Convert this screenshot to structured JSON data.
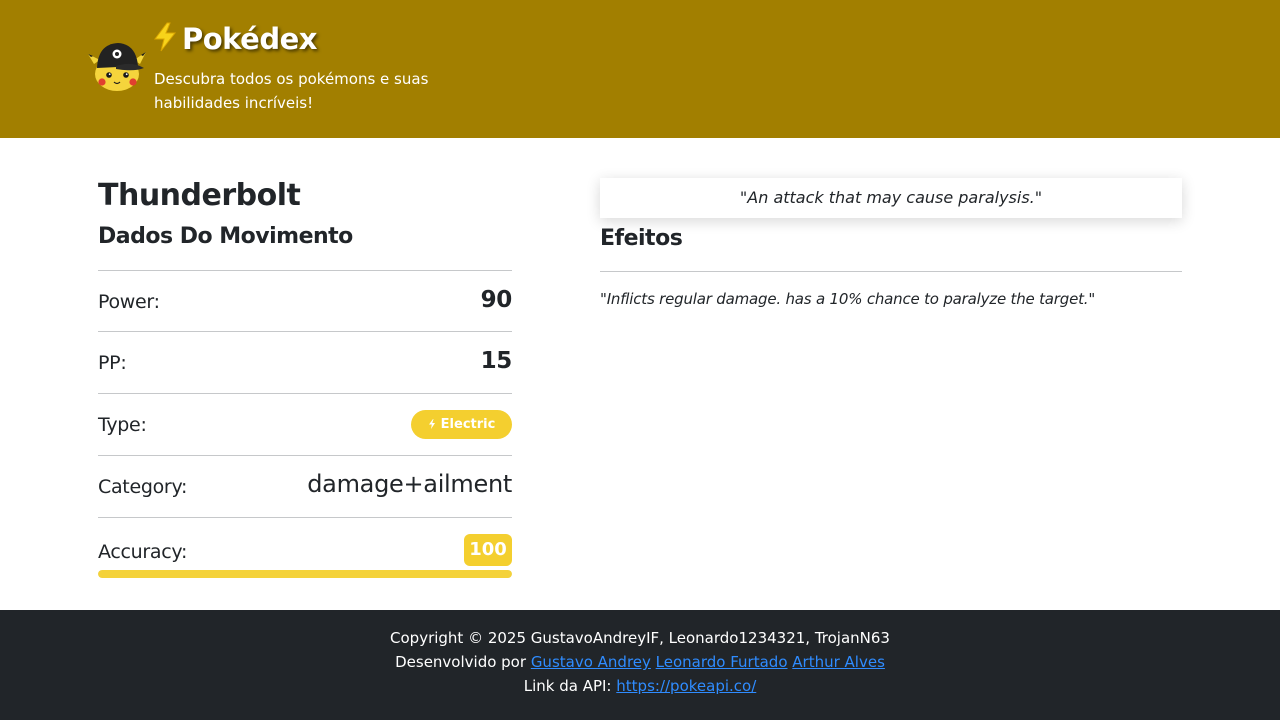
{
  "header": {
    "logo_icon": "pikachu-cap-icon",
    "title_icon": "lightning-bolt-icon",
    "title": "Pokédex",
    "subtitle": "Descubra todos os pokémons e suas habilidades incríveis!",
    "background_color": "#a27f00"
  },
  "move": {
    "name": "Thunderbolt",
    "section_title": "Dados Do Movimento",
    "stats": {
      "power": {
        "label": "Power:",
        "value": "90"
      },
      "pp": {
        "label": "PP:",
        "value": "15"
      },
      "type": {
        "label": "Type:",
        "value": "Electric",
        "icon": "electric-type-icon",
        "color": "#f4cf2f"
      },
      "category": {
        "label": "Category:",
        "value": "damage+ailment"
      },
      "accuracy": {
        "label": "Accuracy:",
        "value": "100",
        "percent": 100,
        "color": "#f4d23a"
      }
    }
  },
  "flavor_text": "\"An attack that may cause paralysis.\"",
  "effects": {
    "title": "Efeitos",
    "text": "\"Inflicts regular damage. has a 10% chance to paralyze the target.\""
  },
  "footer": {
    "copyright": "Copyright © 2025 GustavoAndreyIF, Leonardo1234321, TrojanN63",
    "developed_label": "Desenvolvido por",
    "developers": [
      "Gustavo Andrey",
      "Leonardo Furtado",
      "Arthur Alves"
    ],
    "api_label": "Link da API:",
    "api_link": "https://pokeapi.co/",
    "link_color": "#2f8cff",
    "background_color": "#212529"
  }
}
